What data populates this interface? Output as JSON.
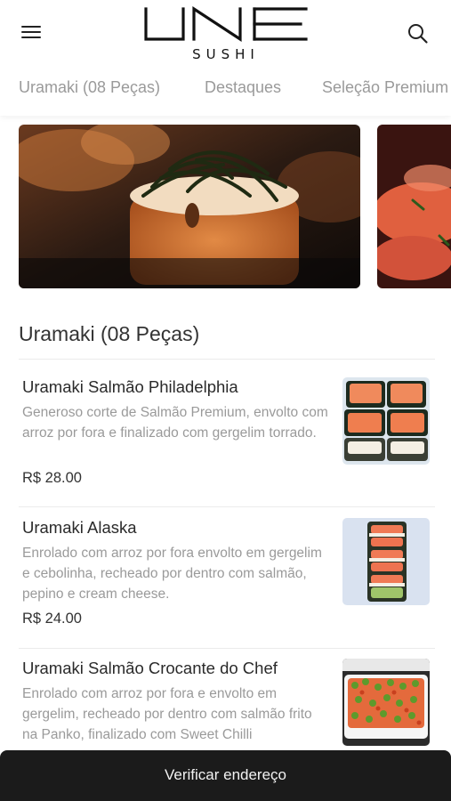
{
  "header": {
    "logo_sub": "SUSHI",
    "menu_icon": "hamburger-menu-icon",
    "search_icon": "search-icon"
  },
  "tabs": [
    {
      "label": "Uramaki (08 Peças)"
    },
    {
      "label": "Destaques"
    },
    {
      "label": "Seleção Premium"
    }
  ],
  "section": {
    "title": "Uramaki (08 Peças)"
  },
  "items": [
    {
      "name": "Uramaki Salmão Philadelphia",
      "description": "Generoso corte de Salmão Premium, envolto com arroz por fora e finalizado com gergelim torrado.",
      "price": "R$ 28.00"
    },
    {
      "name": "Uramaki Alaska",
      "description": "Enrolado com arroz por fora envolto em gergelim e cebolinha, recheado por dentro com salmão, pepino e cream cheese.",
      "price": "R$ 24.00"
    },
    {
      "name": "Uramaki Salmão Crocante do Chef",
      "description": "Enrolado com arroz por fora e envolto em gergelim, recheado por dentro com salmão frito na Panko, finalizado com Sweet Chilli",
      "price": ""
    }
  ],
  "bottom_bar": {
    "label": "Verificar endereço"
  },
  "colors": {
    "bottom_bar": "#1b1b1b",
    "tab_text": "#9a9a9a",
    "description_text": "#9a9a9a"
  }
}
